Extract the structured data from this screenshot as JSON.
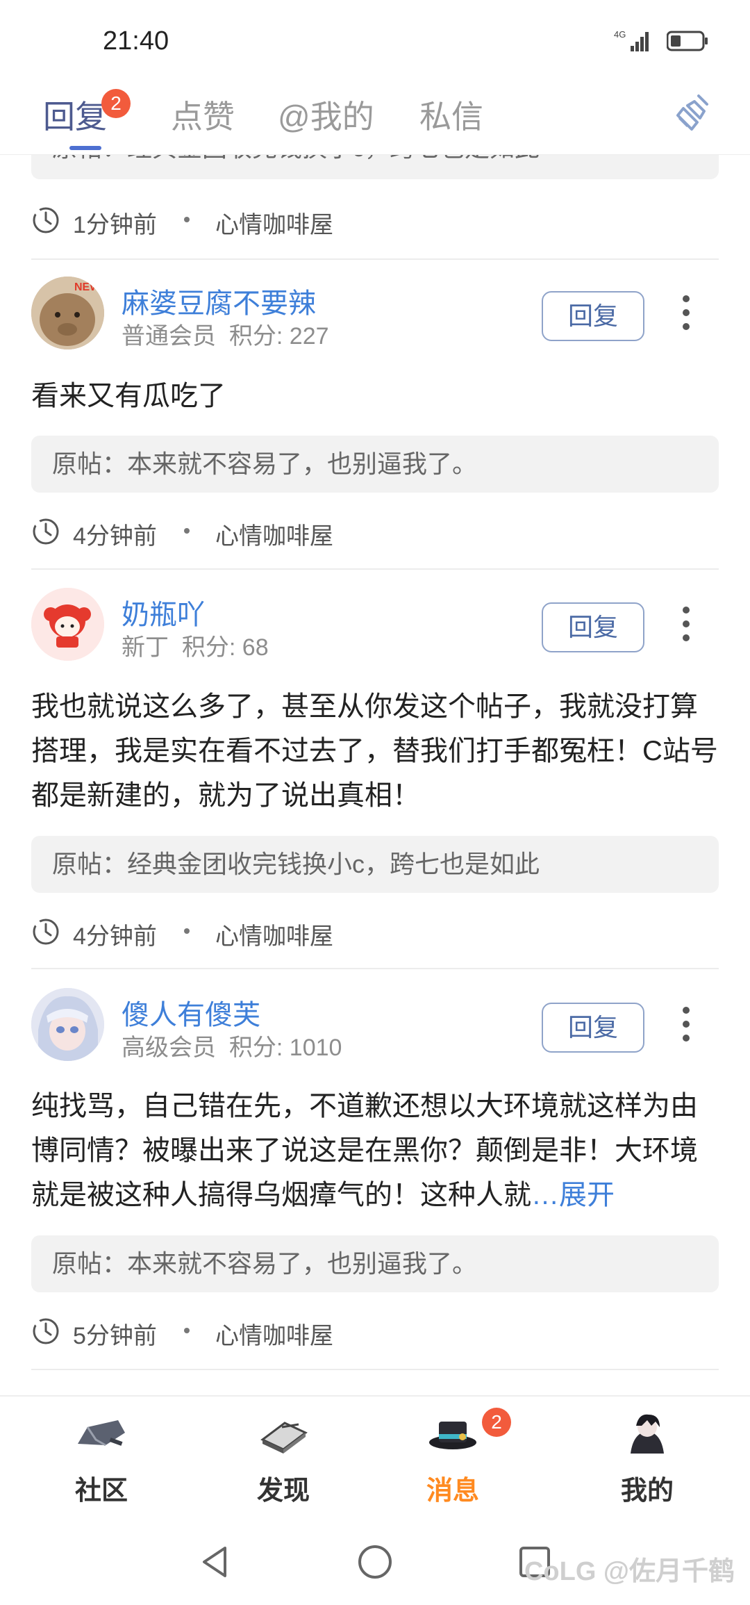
{
  "status_bar": {
    "time": "21:40",
    "network": "4G"
  },
  "tabs": [
    {
      "label": "回复",
      "badge": "2"
    },
    {
      "label": "点赞"
    },
    {
      "label": "@我的"
    },
    {
      "label": "私信"
    }
  ],
  "top_item": {
    "original": "原帖：经典金团收完钱换小c，跨七也是如此",
    "time": "1分钟前",
    "category": "心情咖啡屋"
  },
  "items": [
    {
      "username": "麻婆豆腐不要辣",
      "level": "普通会员",
      "score": "积分: 227",
      "content": "看来又有瓜吃了",
      "original": "原帖：本来就不容易了，也别逼我了。",
      "time": "4分钟前",
      "category": "心情咖啡屋",
      "avatar_badge": "NEW"
    },
    {
      "username": "奶瓶吖",
      "level": "新丁",
      "score": "积分: 68",
      "content": "我也就说这么多了，甚至从你发这个帖子，我就没打算搭理，我是实在看不过去了，替我们打手都冤枉！C站号都是新建的，就为了说出真相！",
      "original": "原帖：经典金团收完钱换小c，跨七也是如此",
      "time": "4分钟前",
      "category": "心情咖啡屋"
    },
    {
      "username": "傻人有傻芙",
      "level": "高级会员",
      "score": "积分: 1010",
      "content": "纯找骂，自己错在先，不道歉还想以大环境就这样为由博同情？被曝出来了说这是在黑你？颠倒是非！大环境就是被这种人搞得乌烟瘴气的！这种人就",
      "expand": "…展开",
      "original": "原帖：本来就不容易了，也别逼我了。",
      "time": "5分钟前",
      "category": "心情咖啡屋"
    }
  ],
  "reply_label": "回复",
  "bottom_nav": [
    {
      "label": "社区"
    },
    {
      "label": "发现"
    },
    {
      "label": "消息",
      "badge": "2"
    },
    {
      "label": "我的"
    }
  ],
  "watermark": "CoLG @佐月千鹤",
  "colors": {
    "accent_blue": "#3e7fd9",
    "tab_active": "#4d5a8f",
    "badge": "#f25b3c",
    "nav_active": "#ff8a20"
  }
}
